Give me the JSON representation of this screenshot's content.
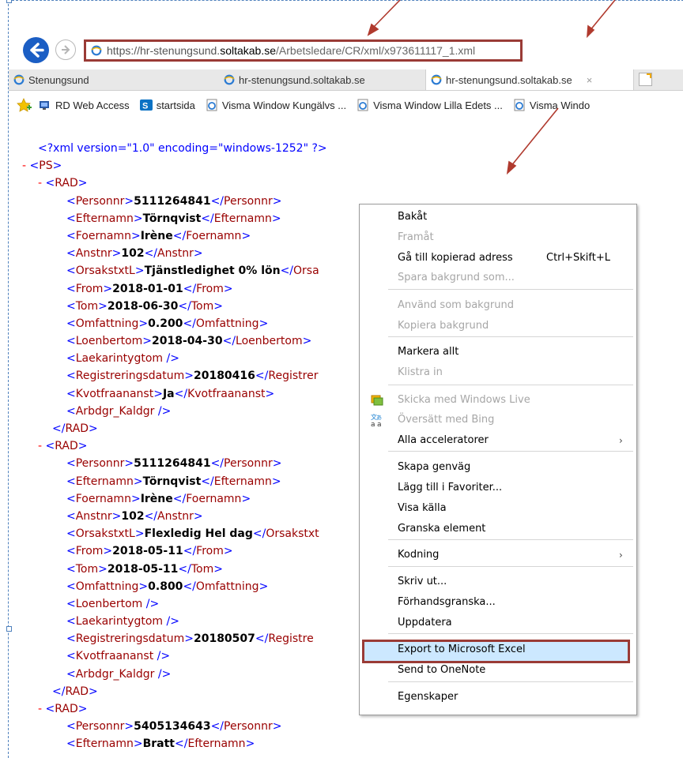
{
  "browser": {
    "address_url": {
      "prefix": "https://hr-stenungsund.",
      "domain": "soltakab.se",
      "path": "/Arbetsledare/CR/xml/x973611117_1.xml"
    },
    "tabs": [
      {
        "label": "Stenungsund"
      },
      {
        "label": "hr-stenungsund.soltakab.se"
      },
      {
        "label": "hr-stenungsund.soltakab.se",
        "close": "×"
      }
    ],
    "favorites": [
      {
        "label": "RD Web Access",
        "icon": "rd-web-access-icon"
      },
      {
        "label": "startsida",
        "icon": "sharepoint-icon"
      },
      {
        "label": "Visma Window Kungälvs ...",
        "icon": "ie-page-icon"
      },
      {
        "label": "Visma Window Lilla Edets ...",
        "icon": "ie-page-icon"
      },
      {
        "label": "Visma Windo",
        "icon": "ie-page-icon"
      }
    ]
  },
  "xml_view": {
    "declaration": "<?xml version=\"1.0\" encoding=\"windows-1252\" ?>",
    "root_tag": "PS",
    "records": [
      {
        "tag": "RAD",
        "fields": [
          {
            "tag": "Personnr",
            "value": "5111264841"
          },
          {
            "tag": "Efternamn",
            "value": "Törnqvist"
          },
          {
            "tag": "Foernamn",
            "value": "Irène"
          },
          {
            "tag": "Anstnr",
            "value": "102"
          },
          {
            "tag": "OrsakstxtL",
            "value": "Tjänstledighet 0% lön",
            "close": "</Orsa"
          },
          {
            "tag": "From",
            "value": "2018-01-01"
          },
          {
            "tag": "Tom",
            "value": "2018-06-30"
          },
          {
            "tag": "Omfattning",
            "value": "0.200"
          },
          {
            "tag": "Loenbertom",
            "value": "2018-04-30"
          },
          {
            "tag": "Laekarintygtom",
            "value": ""
          },
          {
            "tag": "Registreringsdatum",
            "value": "20180416",
            "close": "</Registrer"
          },
          {
            "tag": "Kvotfraananst",
            "value": "Ja"
          },
          {
            "tag": "Arbdgr_Kaldgr",
            "value": ""
          }
        ]
      },
      {
        "tag": "RAD",
        "fields": [
          {
            "tag": "Personnr",
            "value": "5111264841"
          },
          {
            "tag": "Efternamn",
            "value": "Törnqvist"
          },
          {
            "tag": "Foernamn",
            "value": "Irène"
          },
          {
            "tag": "Anstnr",
            "value": "102"
          },
          {
            "tag": "OrsakstxtL",
            "value": "Flexledig Hel dag",
            "close": "</Orsakstxt"
          },
          {
            "tag": "From",
            "value": "2018-05-11"
          },
          {
            "tag": "Tom",
            "value": "2018-05-11"
          },
          {
            "tag": "Omfattning",
            "value": "0.800"
          },
          {
            "tag": "Loenbertom",
            "value": ""
          },
          {
            "tag": "Laekarintygtom",
            "value": ""
          },
          {
            "tag": "Registreringsdatum",
            "value": "20180507",
            "close": "</Registre"
          },
          {
            "tag": "Kvotfraananst",
            "value": ""
          },
          {
            "tag": "Arbdgr_Kaldgr",
            "value": ""
          }
        ]
      },
      {
        "tag": "RAD",
        "fields": [
          {
            "tag": "Personnr",
            "value": "5405134643"
          },
          {
            "tag": "Efternamn",
            "value": "Bratt"
          }
        ]
      }
    ]
  },
  "context_menu": {
    "items": [
      {
        "label": "Bakåt",
        "enabled": true
      },
      {
        "label": "Framåt",
        "enabled": false
      },
      {
        "label": "Gå till kopierad adress",
        "shortcut": "Ctrl+Skift+L",
        "enabled": true
      },
      {
        "label": "Spara bakgrund som...",
        "enabled": false
      },
      {
        "label": "Använd som bakgrund",
        "enabled": false
      },
      {
        "label": "Kopiera bakgrund",
        "enabled": false
      },
      {
        "label": "Markera allt",
        "enabled": true
      },
      {
        "label": "Klistra in",
        "enabled": false
      },
      {
        "label": "Skicka med Windows Live",
        "enabled": false,
        "icon": "windows-live-icon"
      },
      {
        "label": "Översätt med Bing",
        "enabled": false,
        "icon": "translate-icon"
      },
      {
        "label": "Alla acceleratorer",
        "enabled": true,
        "submenu": "›"
      },
      {
        "label": "Skapa genväg",
        "enabled": true
      },
      {
        "label": "Lägg till i Favoriter...",
        "enabled": true
      },
      {
        "label": "Visa källa",
        "enabled": true
      },
      {
        "label": "Granska element",
        "enabled": true
      },
      {
        "label": "Kodning",
        "enabled": true,
        "submenu": "›"
      },
      {
        "label": "Skriv ut...",
        "enabled": true
      },
      {
        "label": "Förhandsgranska...",
        "enabled": true
      },
      {
        "label": "Uppdatera",
        "enabled": true
      },
      {
        "label": "Export to Microsoft Excel",
        "enabled": true,
        "highlighted": true
      },
      {
        "label": "Send to OneNote",
        "enabled": true
      },
      {
        "label": "Egenskaper",
        "enabled": true
      }
    ]
  },
  "colors": {
    "annotation": "#9a3b36",
    "xml_tag": "#990000",
    "xml_punct": "#0000ff",
    "highlight": "#cce8ff"
  }
}
